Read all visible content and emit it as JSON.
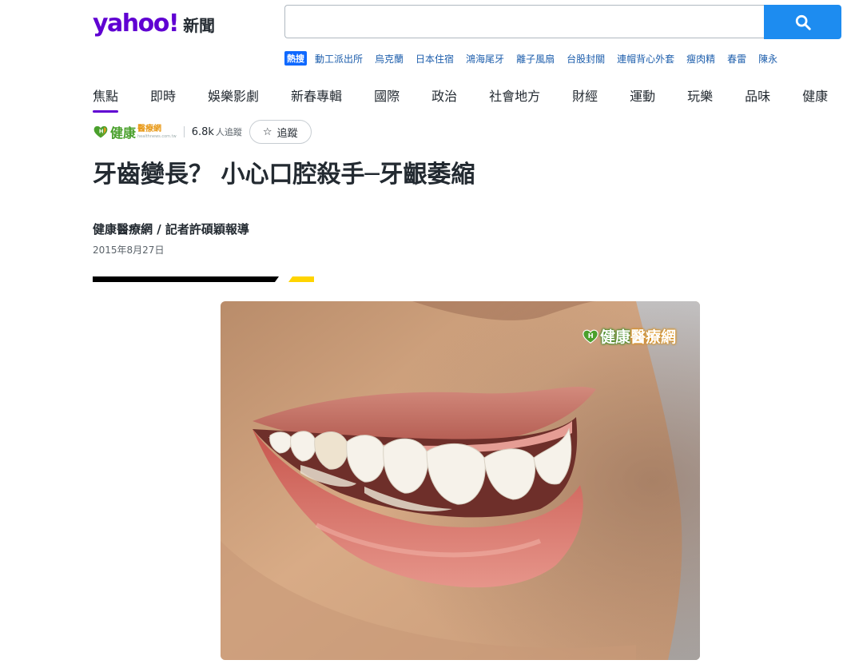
{
  "header": {
    "logo_text": "yahoo!",
    "logo_section": "新聞",
    "search": {
      "value": "",
      "placeholder": ""
    },
    "hot_label": "熱搜",
    "hot_searches": [
      "動工派出所",
      "烏克蘭",
      "日本住宿",
      "鴻海尾牙",
      "離子風扇",
      "台股封關",
      "連帽背心外套",
      "瘦肉精",
      "春雷",
      "陳永"
    ]
  },
  "nav": {
    "items": [
      "焦點",
      "即時",
      "娛樂影劇",
      "新春專輯",
      "國際",
      "政治",
      "社會地方",
      "財經",
      "運動",
      "玩樂",
      "品味",
      "健康"
    ],
    "active": "焦點"
  },
  "article": {
    "source": {
      "name": "健康",
      "name_sub": "醫療網",
      "url_text": "healthnews.com.tw",
      "followers": "6.8k",
      "followers_label": "人追蹤",
      "follow_label": "追蹤"
    },
    "title": "牙齒變長？ 小心口腔殺手─牙齦萎縮",
    "byline": "健康醫療網 / 記者許碩穎報導",
    "date": "2015年8月27日",
    "image_watermark": {
      "part1": "健康",
      "part2": "醫療網"
    }
  },
  "colors": {
    "brand_purple": "#6001d2",
    "search_blue": "#1d8cf0",
    "hot_badge_blue": "#0f69ff",
    "accent_yellow": "#ffd400",
    "source_green": "#4aa02c",
    "source_orange": "#e89a1a"
  },
  "icons": {
    "search": "search-icon",
    "follow": "star-icon",
    "source_logo": "heart-h-icon"
  }
}
